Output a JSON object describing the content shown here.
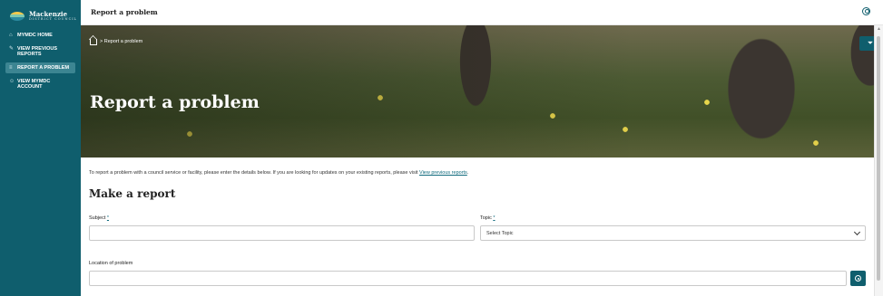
{
  "sidebar": {
    "logo": {
      "name": "Mackenzie",
      "tagline": "DISTRICT COUNCIL"
    },
    "items": [
      {
        "label": "MYMDC HOME",
        "icon": "home-icon",
        "active": false
      },
      {
        "label": "VIEW PREVIOUS REPORTS",
        "icon": "edit-icon",
        "active": false
      },
      {
        "label": "REPORT A PROBLEM",
        "icon": "list-icon",
        "active": true
      },
      {
        "label": "VIEW MYMDC ACCOUNT",
        "icon": "user-icon",
        "active": false
      }
    ]
  },
  "topbar": {
    "title": "Report a problem",
    "account_icon": "user-circle-icon"
  },
  "hero": {
    "breadcrumb": "> Report a problem",
    "title": "Report a problem"
  },
  "form": {
    "intro_text": "To report a problem with a council service or facility, please enter the details below. If you are looking for updates on your existing reports, please visit ",
    "intro_link": "View previous reports",
    "intro_end": ".",
    "section_title": "Make a report",
    "subject": {
      "label": "Subject",
      "required_mark": "*",
      "value": ""
    },
    "topic": {
      "label": "Topic",
      "required_mark": "*",
      "selected": "Select Topic"
    },
    "location": {
      "label": "Location of problem",
      "value": ""
    }
  },
  "colors": {
    "brand": "#0f5e6d",
    "active_nav": "#3c8592",
    "link": "#0f6a7d"
  }
}
